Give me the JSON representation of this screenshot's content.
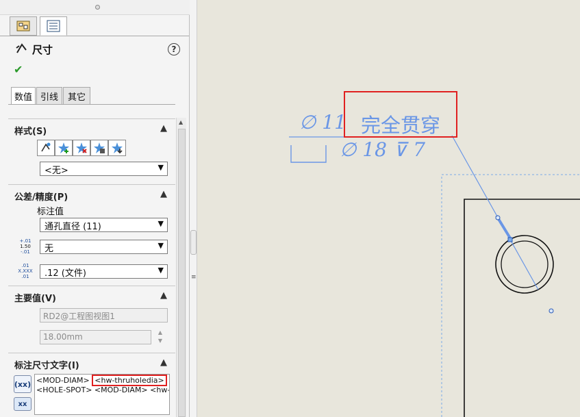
{
  "panel": {
    "title": "尺寸",
    "help": "?",
    "ok": "✔",
    "subtabs": [
      "数值",
      "引线",
      "其它"
    ],
    "style_group": {
      "title": "样式(S)",
      "dropdown_value": "<无>",
      "icons": [
        "apply-defaults-icon",
        "add-style-icon",
        "delete-style-icon",
        "save-style-icon",
        "load-style-icon"
      ]
    },
    "tolerance_group": {
      "title": "公差/精度(P)",
      "callout_label": "标注值",
      "callout_value": "通孔直径 (11)",
      "tolerance_icon_text": [
        "+.01",
        "1.50",
        "-.01"
      ],
      "tolerance_value": "无",
      "precision_icon_text": [
        ".01",
        "X.XXX",
        ".01"
      ],
      "precision_value": ".12 (文件)"
    },
    "primary_group": {
      "title": "主要值(V)",
      "name_value": "RD2@工程图视图1",
      "size_value": "18.00mm"
    },
    "text_group": {
      "title": "标注尺寸文字(I)",
      "line1_a": "<MOD-DIAM>",
      "line1_b": "<hw-thruholedia>",
      "line2": "<HOLE-SPOT> <MOD-DIAM> <hw-"
    }
  },
  "drawing": {
    "callout_line1_prefix": "∅ 11",
    "callout_line1_suffix": "完全贯穿",
    "callout_line2": "∅ 18 ⊽ 7",
    "dim_color": "#6a96e6",
    "highlight_color": "#e02020"
  }
}
